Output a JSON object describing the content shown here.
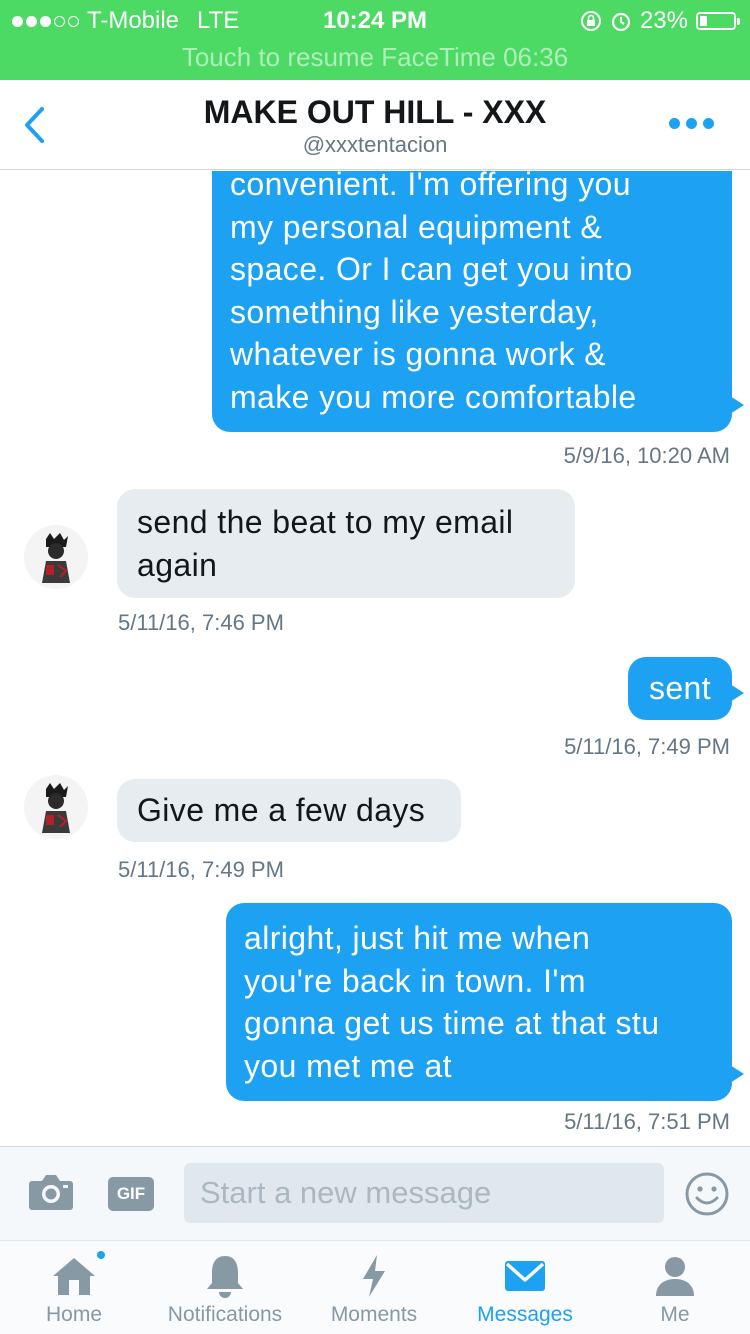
{
  "status_bar": {
    "carrier": "T-Mobile",
    "network": "LTE",
    "time": "10:24 PM",
    "battery": "23%",
    "battery_level": 0.23,
    "signal_bars_filled": 3,
    "signal_bars_total": 5,
    "facetime_banner": "Touch to resume FaceTime  06:36"
  },
  "header": {
    "title": "MAKE OUT HILL - XXX",
    "handle": "@xxxtentacion"
  },
  "messages": [
    {
      "direction": "outgoing",
      "lines": [
        "convenient. I'm offering you",
        "my personal equipment &",
        "space. Or I can get you into",
        "something like yesterday,",
        "whatever is gonna work &",
        "make you more comfortable"
      ],
      "timestamp": "5/9/16, 10:20 AM"
    },
    {
      "direction": "incoming",
      "lines": [
        "send the beat to my email",
        "again"
      ],
      "timestamp": "5/11/16, 7:46 PM"
    },
    {
      "direction": "outgoing",
      "lines": [
        "sent"
      ],
      "timestamp": "5/11/16, 7:49 PM"
    },
    {
      "direction": "incoming",
      "lines": [
        "Give me a few days"
      ],
      "timestamp": "5/11/16, 7:49 PM"
    },
    {
      "direction": "outgoing",
      "lines": [
        "alright, just hit me when",
        "you're back in town. I'm",
        "gonna get us time at that stu",
        "you met me at"
      ],
      "timestamp": "5/11/16, 7:51 PM"
    }
  ],
  "composer": {
    "placeholder": "Start a new message",
    "gif_label": "GIF",
    "camera_icon": "camera-icon",
    "emoji_icon": "emoji-icon"
  },
  "tabs": [
    {
      "label": "Home",
      "icon": "home-icon",
      "active": false,
      "has_badge": true
    },
    {
      "label": "Notifications",
      "icon": "bell-icon",
      "active": false,
      "has_badge": false
    },
    {
      "label": "Moments",
      "icon": "lightning-icon",
      "active": false,
      "has_badge": false
    },
    {
      "label": "Messages",
      "icon": "envelope-icon",
      "active": true,
      "has_badge": false
    },
    {
      "label": "Me",
      "icon": "person-icon",
      "active": false,
      "has_badge": false
    }
  ],
  "colors": {
    "status_bar": "#4cd964",
    "accent": "#1da1f2",
    "incoming_bubble": "#e6ecf0",
    "inactive_icon": "#8899a6"
  }
}
